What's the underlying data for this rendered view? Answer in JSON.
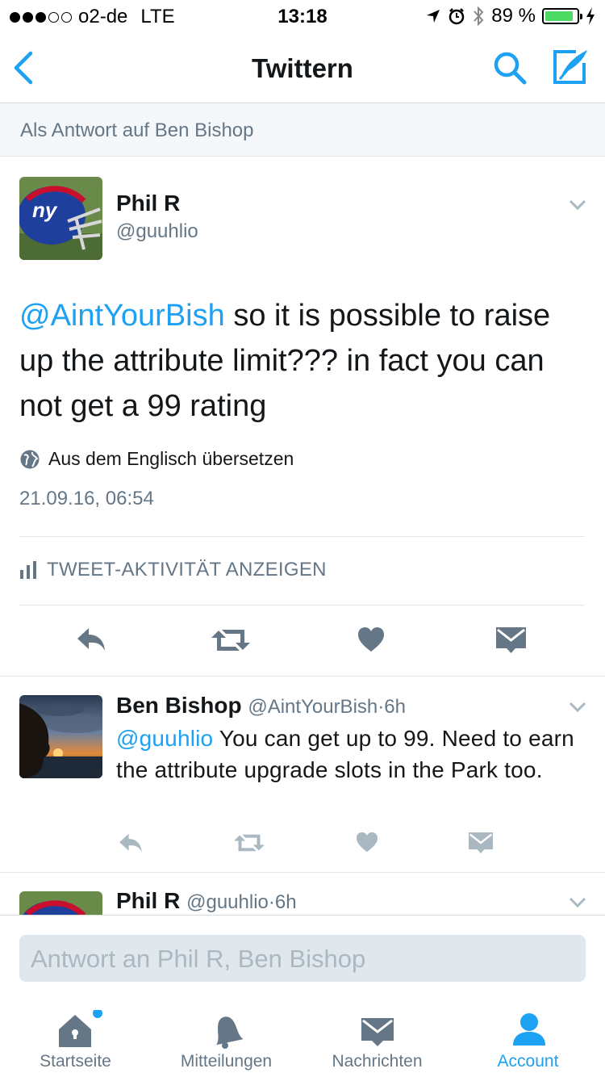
{
  "status_bar": {
    "carrier": "o2-de",
    "network": "LTE",
    "time": "13:18",
    "battery_text": "89 %",
    "battery_level": 0.89,
    "signal_bars_filled": 3,
    "signal_bars_total": 5
  },
  "nav": {
    "title": "Twittern",
    "back_icon": "chevron-left-icon",
    "search_icon": "search-icon",
    "compose_icon": "compose-icon"
  },
  "reply_banner": "Als Antwort auf Ben Bishop",
  "main_tweet": {
    "name": "Phil R",
    "handle": "@guuhlio",
    "mention": "@AintYourBish",
    "text": " so it is possible to raise up the attribute limit??? in fact you can not get a 99 rating",
    "translate_label": "Aus dem Englisch übersetzen",
    "timestamp": "21.09.16, 06:54",
    "activity_label": "TWEET-AKTIVITÄT ANZEIGEN"
  },
  "reply_tweet": {
    "name": "Ben Bishop",
    "handle": "@AintYourBish",
    "separator": "·",
    "time": "6h",
    "mention": "@guuhlio",
    "text": " You can get up to 99. Need to earn the attribute upgrade slots in the Park too."
  },
  "next_tweet": {
    "name": "Phil R",
    "handle": "@guuhlio",
    "separator": "·",
    "time": "6h"
  },
  "composer": {
    "placeholder": "Antwort an Phil R, Ben Bishop"
  },
  "tabs": [
    {
      "label": "Startseite",
      "icon": "home-icon",
      "active": false
    },
    {
      "label": "Mitteilungen",
      "icon": "bell-icon",
      "active": false
    },
    {
      "label": "Nachrichten",
      "icon": "envelope-icon",
      "active": false
    },
    {
      "label": "Account",
      "icon": "person-icon",
      "active": true
    }
  ],
  "colors": {
    "accent": "#1da1f2",
    "gray_text": "#657786",
    "icon_gray": "#aab8c2",
    "action_gray": "#657786",
    "battery_green": "#4cd964"
  }
}
